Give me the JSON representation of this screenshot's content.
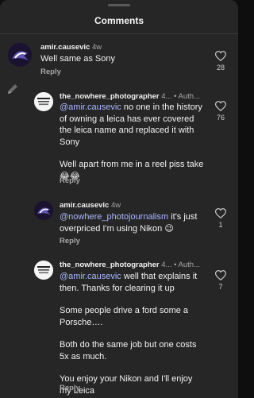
{
  "header": {
    "title": "Comments"
  },
  "comments": [
    {
      "username": "amir.causevic",
      "time": "4w",
      "text": "Well same as Sony",
      "reply_label": "Reply",
      "likes": "28"
    },
    {
      "username": "the_nowhere_photographer",
      "time": "4...",
      "author_badge": "• Auth...",
      "mention": "@amir.causevic",
      "text": " no one in the history of owning a leica has ever covered the leica name and replaced it with Sony",
      "text2": "Well apart from me in a reel piss take 😂😂",
      "reply_label": "Reply",
      "likes": "76"
    },
    {
      "username": "amir.causevic",
      "time": "4w",
      "mention": "@nowhere_photojournalism",
      "text": " it's just overpriced I'm using Nikon 😉",
      "reply_label": "Reply",
      "likes": "1"
    },
    {
      "username": "the_nowhere_photographer",
      "time": "4...",
      "author_badge": "• Auth...",
      "mention": "@amir.causevic",
      "text": " well that explains it then. Thanks for clearing it up",
      "text2": "Some people drive a ford some a Porsche….",
      "text3": "Both do the same job but one costs 5x as much.",
      "text4": "You enjoy your Nikon and I'll enjoy my Leica",
      "reply_label": "Reply",
      "likes": "7"
    }
  ],
  "colors": {
    "background": "#262626",
    "mention": "#a9b8ff",
    "muted": "#a8a8a8"
  },
  "icons": [
    "heart-icon",
    "pencil-icon"
  ]
}
